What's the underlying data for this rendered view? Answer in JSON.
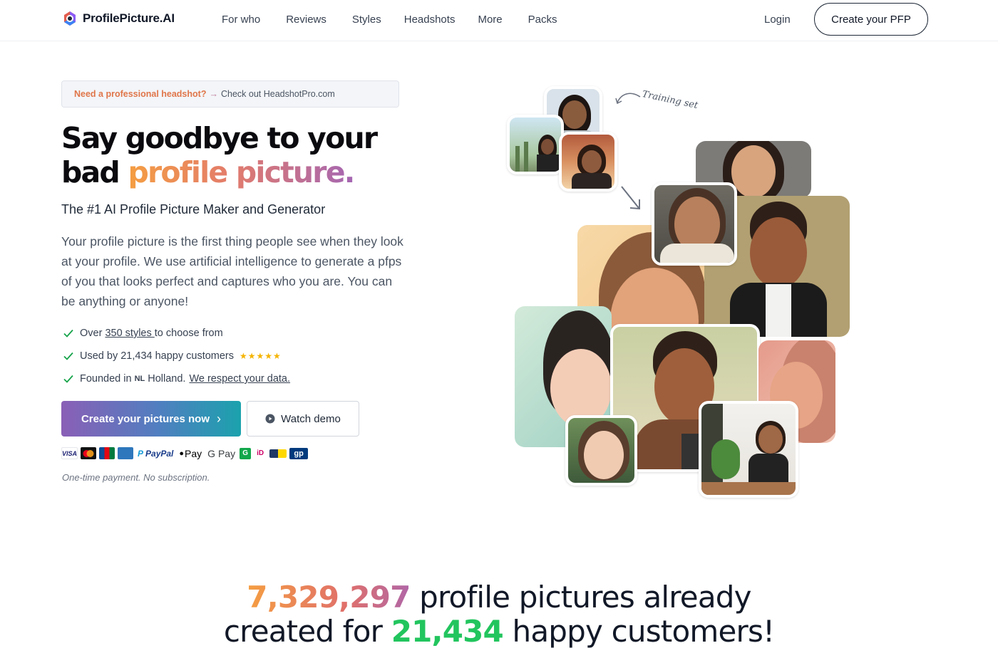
{
  "nav": {
    "brand": "ProfilePicture.AI",
    "links": [
      "For who",
      "Reviews",
      "Styles",
      "Headshots",
      "More",
      "Packs"
    ],
    "login": "Login",
    "cta": "Create your PFP"
  },
  "banner": {
    "strong": "Need a professional headshot?",
    "arrow": "→",
    "rest": "Check out HeadshotPro.com"
  },
  "hero": {
    "title_line1": "Say goodbye to your",
    "title_line2_plain": "bad ",
    "title_line2_highlight": "profile picture.",
    "subtitle": "The #1 AI Profile Picture Maker and Generator",
    "lead": "Your profile picture is the first thing people see when they look at your profile. We use artificial intelligence to generate a pfps of you that looks perfect and captures who you are. You can be anything or anyone!"
  },
  "checks": {
    "c1_pre": "Over ",
    "c1_link": "350 styles ",
    "c1_post": "to choose from",
    "c2_text": "Used by 21,434 happy customers",
    "c2_stars": "★★★★★",
    "c3_pre": "Founded in",
    "c3_flag": "NL",
    "c3_mid": "Holland.",
    "c3_link": "We respect your data."
  },
  "buttons": {
    "primary": "Create your pictures now",
    "primary_chevron": "›",
    "secondary": "Watch demo"
  },
  "payments": {
    "visa": "VISA",
    "paypal": "PayPal",
    "applepay": "Pay",
    "gpay": "G Pay",
    "gp": "gp",
    "note": "One-time payment. No subscription."
  },
  "collage": {
    "training_label": "Training set"
  },
  "stats": {
    "count": "7,329,297",
    "line1_rest": " profile pictures already",
    "line2_pre": "created for ",
    "customers": "21,434",
    "line2_post": " happy customers!"
  },
  "colors": {
    "accent_orange": "#f59e42",
    "accent_purple": "#a466b3",
    "accent_green": "#22c55e",
    "check_green": "#16a34a",
    "star": "#f5b400"
  },
  "icons": [
    "logo-icon",
    "check-icon",
    "chevron-right-icon",
    "play-icon",
    "arrow-icon"
  ]
}
